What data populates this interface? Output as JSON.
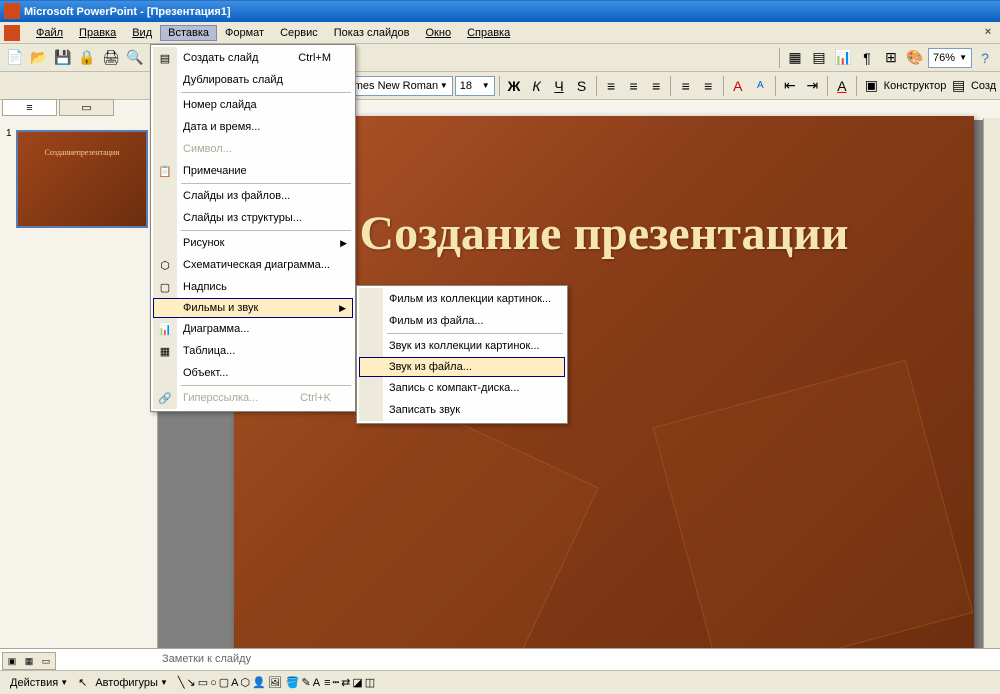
{
  "titlebar": {
    "app_name": "Microsoft PowerPoint",
    "separator": " - ",
    "doc_name": "[Презентация1]"
  },
  "menubar": {
    "file": "Файл",
    "edit": "Правка",
    "view": "Вид",
    "insert": "Вставка",
    "format": "Формат",
    "tools": "Сервис",
    "slideshow": "Показ слайдов",
    "window": "Окно",
    "help": "Справка"
  },
  "toolbar1": {
    "zoom": "76%"
  },
  "toolbar2": {
    "font_name": "Times New Roman",
    "font_size": "18",
    "bold": "Ж",
    "italic": "К",
    "underline": "Ч",
    "shadow": "S",
    "designer": "Конструктор",
    "new_slide": "Созд"
  },
  "insert_menu": {
    "new_slide": "Создать слайд",
    "new_slide_shortcut": "Ctrl+M",
    "duplicate_slide": "Дублировать слайд",
    "slide_number": "Номер слайда",
    "date_time": "Дата и время...",
    "symbol": "Символ...",
    "comment": "Примечание",
    "slides_from_files": "Слайды из файлов...",
    "slides_from_outline": "Слайды из структуры...",
    "picture": "Рисунок",
    "diagram": "Схематическая диаграмма...",
    "textbox": "Надпись",
    "movies_sound": "Фильмы и звук",
    "chart": "Диаграмма...",
    "table": "Таблица...",
    "object": "Объект...",
    "hyperlink": "Гиперссылка...",
    "hyperlink_shortcut": "Ctrl+K"
  },
  "sound_submenu": {
    "movie_gallery": "Фильм из коллекции картинок...",
    "movie_file": "Фильм из файла...",
    "sound_gallery": "Звук из коллекции картинок...",
    "sound_file": "Звук из файла...",
    "cd_audio": "Запись с компакт-диска...",
    "record_sound": "Записать звук"
  },
  "slide": {
    "number": "1",
    "title": "Создание презентации",
    "thumb_title": "Созданиепрезентации"
  },
  "notes": {
    "placeholder": "Заметки к слайду"
  },
  "bottom_toolbar": {
    "actions": "Действия",
    "autoshapes": "Автофигуры"
  },
  "tabs": {
    "outline_icon": "≡",
    "slides_icon": "▭"
  }
}
